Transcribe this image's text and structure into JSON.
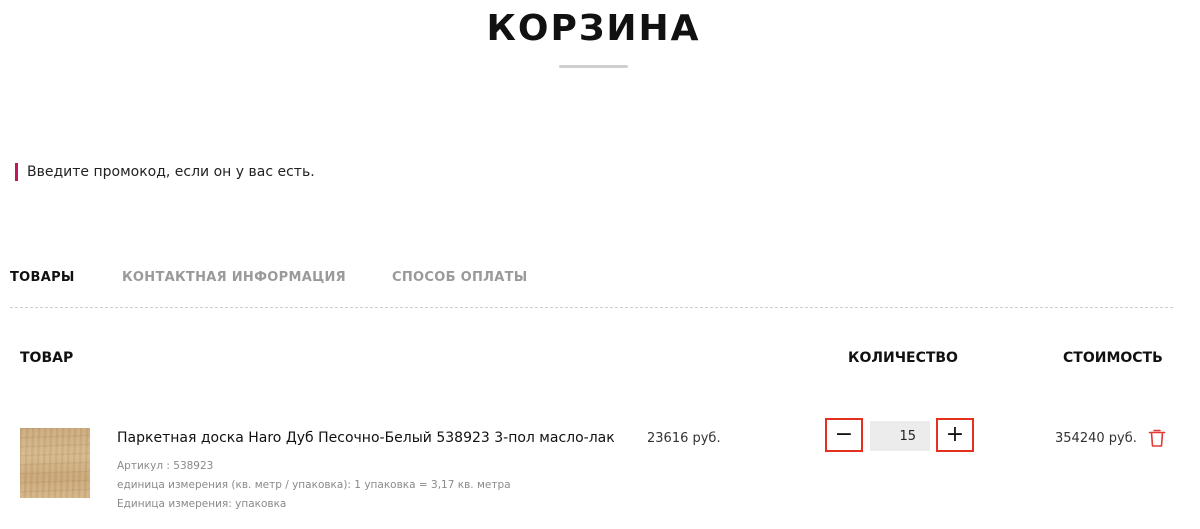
{
  "page": {
    "title": "КОРЗИНА"
  },
  "promo": {
    "text": "Введите промокод, если он у вас есть."
  },
  "tabs": [
    {
      "label": "ТОВАРЫ",
      "active": true
    },
    {
      "label": "КОНТАКТНАЯ ИНФОРМАЦИЯ",
      "active": false
    },
    {
      "label": "СПОСОБ ОПЛАТЫ",
      "active": false
    }
  ],
  "table": {
    "headers": {
      "product": "ТОВАР",
      "quantity": "КОЛИЧЕСТВО",
      "cost": "СТОИМОСТЬ"
    },
    "items": [
      {
        "name": "Паркетная доска Haro Дуб Песочно-Белый 538923 3-пол масло-лак",
        "sku": "Артикул : 538923",
        "unit_info": "единица измерения (кв. метр / упаковка): 1 упаковка = 3,17 кв. метра",
        "unit": "Единица измерения: упаковка",
        "price": "23616 руб.",
        "quantity": "15",
        "total": "354240 руб.",
        "decrement": "−",
        "increment": "+"
      }
    ]
  },
  "icons": {
    "delete": "trash-icon"
  },
  "colors": {
    "accent": "#c2185b",
    "qty_border": "#e53020",
    "delete": "#e53935"
  }
}
